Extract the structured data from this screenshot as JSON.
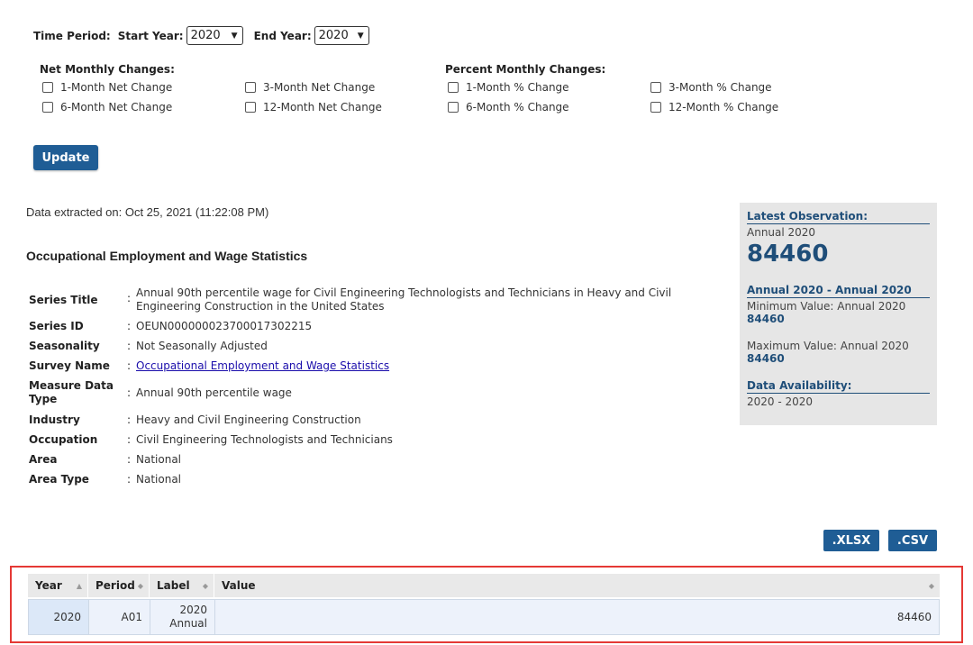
{
  "time_period": {
    "label": "Time Period:",
    "start_label": "Start Year:",
    "start_value": "2020",
    "end_label": "End Year:",
    "end_value": "2020"
  },
  "net_changes": {
    "title": "Net Monthly Changes:",
    "options": [
      "1-Month Net Change",
      "3-Month Net Change",
      "6-Month Net Change",
      "12-Month Net Change"
    ]
  },
  "percent_changes": {
    "title": "Percent Monthly Changes:",
    "options": [
      "1-Month % Change",
      "3-Month % Change",
      "6-Month % Change",
      "12-Month % Change"
    ]
  },
  "update_label": "Update",
  "extracted": "Data extracted on: Oct 25, 2021 (11:22:08 PM)",
  "survey_heading": "Occupational Employment and Wage Statistics",
  "series": {
    "title_key": "Series Title",
    "title_value": "Annual 90th percentile wage for Civil Engineering Technologists and Technicians in Heavy and Civil Engineering Construction in the United States",
    "id_key": "Series ID",
    "id_value": "OEUN000000023700017302215",
    "seasonality_key": "Seasonality",
    "seasonality_value": "Not Seasonally Adjusted",
    "survey_key": "Survey Name",
    "survey_value": "Occupational Employment and Wage Statistics",
    "measure_key": "Measure Data Type",
    "measure_value": "Annual 90th percentile wage",
    "industry_key": "Industry",
    "industry_value": "Heavy and Civil Engineering Construction",
    "occupation_key": "Occupation",
    "occupation_value": "Civil Engineering Technologists and Technicians",
    "area_key": "Area",
    "area_value": "National",
    "area_type_key": "Area Type",
    "area_type_value": "National"
  },
  "sidebar": {
    "latest_title": "Latest Observation:",
    "latest_period": "Annual 2020",
    "latest_value": "84460",
    "range_title": "Annual 2020 - Annual 2020",
    "min_label": "Minimum Value: Annual 2020",
    "min_value": "84460",
    "max_label": "Maximum Value: Annual 2020",
    "max_value": "84460",
    "avail_title": "Data Availability:",
    "avail_value": "2020 - 2020"
  },
  "downloads": {
    "xlsx": ".XLSX",
    "csv": ".CSV"
  },
  "table": {
    "headers": [
      "Year",
      "Period",
      "Label",
      "Value"
    ],
    "row": {
      "year": "2020",
      "period": "A01",
      "label_line1": "2020",
      "label_line2": "Annual",
      "value": "84460"
    }
  },
  "colors": {
    "accent": "#1f5d95",
    "highlight_border": "#e53935",
    "sidebar_bg": "#e6e6e6"
  },
  "icons": {
    "sort": "sort-icon",
    "dropdown": "chevron-down-icon",
    "checkbox": "checkbox-icon"
  }
}
